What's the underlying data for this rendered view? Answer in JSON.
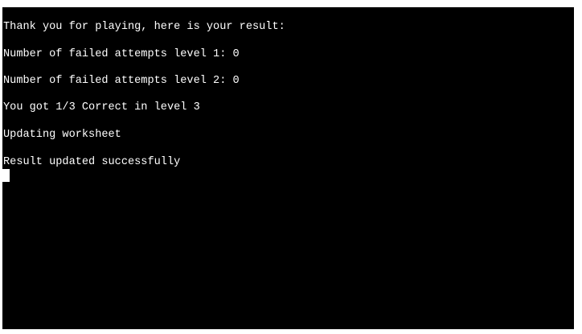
{
  "terminal": {
    "background": "#000000",
    "text_color": "#ffffff",
    "lines": [
      "Thank you for playing, here is your result:",
      "Number of failed attempts level 1: 0",
      "Number of failed attempts level 2: 0",
      "You got 1/3 Correct in level 3",
      "Updating worksheet",
      "Result updated successfully"
    ],
    "cursor_icon": "block-cursor-icon"
  }
}
